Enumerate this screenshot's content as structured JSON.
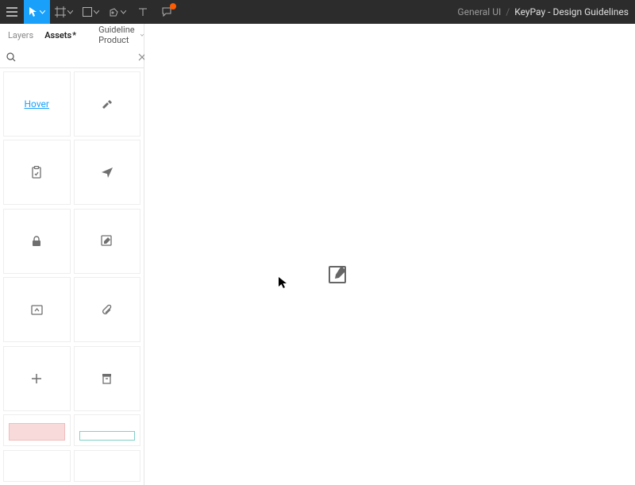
{
  "breadcrumb": {
    "project": "General UI",
    "file": "KeyPay - Design Guidelines"
  },
  "panel": {
    "tabs": {
      "layers": "Layers",
      "assets": "Assets"
    },
    "assets_dirty_mark": "*",
    "page_selector": "Guideline Product"
  },
  "search": {
    "placeholder": ""
  },
  "assets": {
    "hover_label": "Hover"
  }
}
